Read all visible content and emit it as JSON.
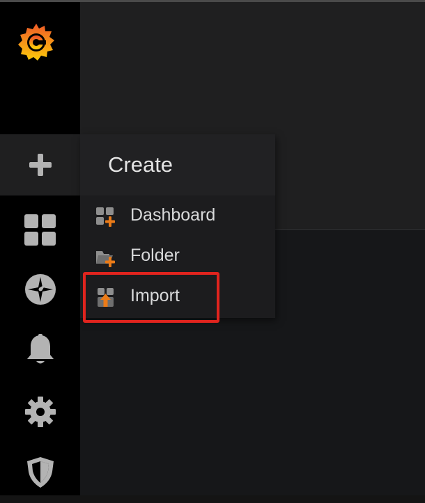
{
  "colors": {
    "sidebar_bg": "#000000",
    "menu_bg": "#1c1c1e",
    "icon_gray": "#b3b3b3",
    "accent_orange": "#eb7b18",
    "highlight_red": "#e0241e"
  },
  "sidebar": {
    "logo_icon": "grafana-logo-icon",
    "items": [
      {
        "icon": "plus-icon",
        "active": true
      },
      {
        "icon": "dashboards-grid-icon"
      },
      {
        "icon": "compass-icon"
      },
      {
        "icon": "bell-icon"
      },
      {
        "icon": "gear-icon"
      },
      {
        "icon": "shield-icon"
      }
    ]
  },
  "create_menu": {
    "title": "Create",
    "items": [
      {
        "label": "Dashboard",
        "icon": "dashboard-add-icon"
      },
      {
        "label": "Folder",
        "icon": "folder-add-icon"
      },
      {
        "label": "Import",
        "icon": "import-icon"
      }
    ]
  }
}
